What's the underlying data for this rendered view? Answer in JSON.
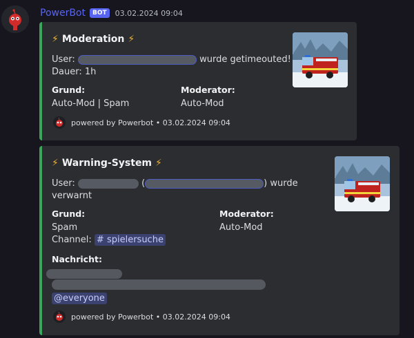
{
  "message": {
    "author": "PowerBot",
    "bot_tag": "BOT",
    "timestamp": "03.02.2024 09:04"
  },
  "embed1": {
    "title": "Moderation",
    "user_prefix": "User:",
    "user_suffix": "wurde getimeouted!",
    "duration": "Dauer: 1h",
    "reason_label": "Grund:",
    "reason_value": "Auto-Mod | Spam",
    "moderator_label": "Moderator:",
    "moderator_value": "Auto-Mod",
    "footer": "powered by Powerbot • 03.02.2024 09:04"
  },
  "embed2": {
    "title": "Warning-System",
    "user_prefix": "User:",
    "user_suffix_1": ") wurde",
    "user_suffix_2": "verwarnt",
    "reason_label": "Grund:",
    "reason_value": "Spam",
    "channel_prefix": "Channel:",
    "channel_name": "spielersuche",
    "moderator_label": "Moderator:",
    "moderator_value": "Auto-Mod",
    "message_label": "Nachricht:",
    "everyone_mention": "@everyone",
    "footer": "powered by Powerbot • 03.02.2024 09:04"
  },
  "colors": {
    "embed_border": "#3ba55c",
    "embed_bg": "#2b2d31",
    "page_bg": "#17161f",
    "author": "#5865f2",
    "mention_bg": "#3c4270"
  },
  "icons": {
    "title_icon": "lightning-bolt-icon",
    "channel_icon": "hash-icon"
  }
}
